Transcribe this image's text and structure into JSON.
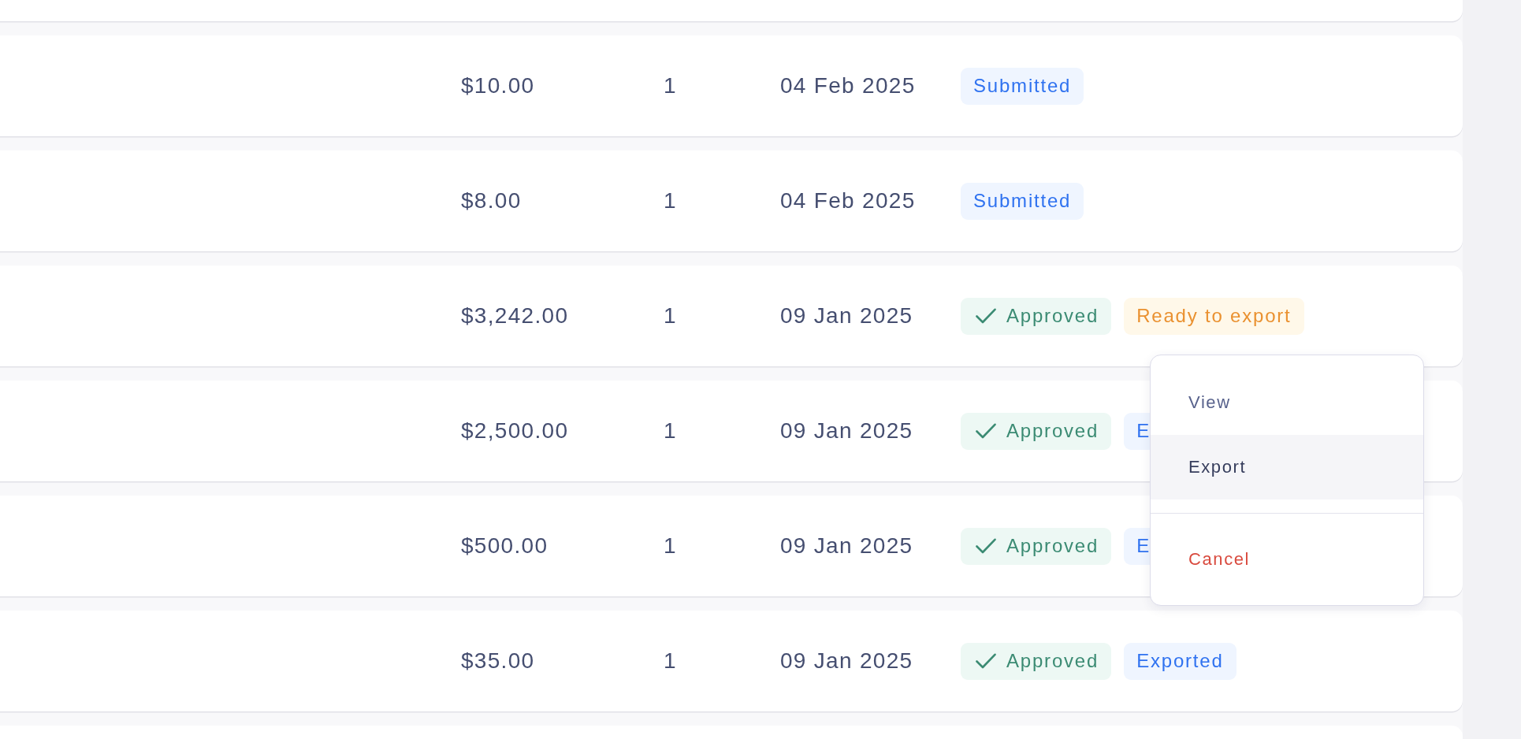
{
  "table": {
    "more_above": true,
    "rows": [
      {
        "cells": [
          "$10.00",
          "1",
          "04 Feb 2025"
        ],
        "badges": [
          {
            "label": "Submitted",
            "kind": "info"
          }
        ]
      },
      {
        "cells": [
          "$8.00",
          "1",
          "04 Feb 2025"
        ],
        "badges": [
          {
            "label": "Submitted",
            "kind": "info"
          }
        ]
      },
      {
        "cells": [
          "$3,242.00",
          "1",
          "09 Jan 2025"
        ],
        "badges": [
          {
            "label": "Approved",
            "kind": "success"
          },
          {
            "label": "Ready to export",
            "kind": "warning"
          }
        ],
        "menu": {
          "groups": [
            [
              {
                "label": "View",
                "kind": "default",
                "selected": false
              },
              {
                "label": "Export",
                "kind": "default",
                "selected": true
              }
            ],
            [
              {
                "label": "Cancel",
                "kind": "danger",
                "selected": false
              }
            ]
          ]
        }
      },
      {
        "cells": [
          "$2,500.00",
          "1",
          "09 Jan 2025"
        ],
        "badges": [
          {
            "label": "Approved",
            "kind": "success"
          },
          {
            "label": "E",
            "kind": "info"
          }
        ]
      },
      {
        "cells": [
          "$500.00",
          "1",
          "09 Jan 2025"
        ],
        "badges": [
          {
            "label": "Approved",
            "kind": "success"
          },
          {
            "label": "E",
            "kind": "info"
          }
        ]
      },
      {
        "cells": [
          "$35.00",
          "1",
          "09 Jan 2025"
        ],
        "badges": [
          {
            "label": "Approved",
            "kind": "success"
          },
          {
            "label": "Exported",
            "kind": "info"
          }
        ]
      }
    ],
    "more_below": true
  }
}
